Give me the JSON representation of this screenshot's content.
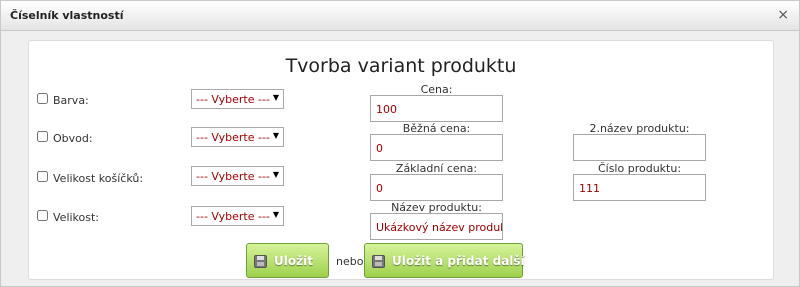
{
  "dialog": {
    "title": "Číselník vlastností",
    "close_glyph": "×"
  },
  "heading": "Tvorba variant produktu",
  "properties": [
    {
      "label": "Barva:",
      "checked": false,
      "select": "--- Vyberte ---"
    },
    {
      "label": "Obvod:",
      "checked": false,
      "select": "--- Vyberte ---"
    },
    {
      "label": "Velikost košíčků:",
      "checked": false,
      "select": "--- Vyberte ---"
    },
    {
      "label": "Velikost:",
      "checked": false,
      "select": "--- Vyberte ---"
    }
  ],
  "select_arrow": "▼",
  "fields": {
    "cena": {
      "label": "Cena:",
      "value": "100"
    },
    "bezna_cena": {
      "label": "Běžná cena:",
      "value": "0"
    },
    "zakladni_cena": {
      "label": "Základní cena:",
      "value": "0"
    },
    "nazev_produktu": {
      "label": "Název produktu:",
      "value": "Ukázkový název produk"
    },
    "nazev2": {
      "label": "2.název produktu:",
      "value": ""
    },
    "cislo_produktu": {
      "label": "Číslo produktu:",
      "value": "111"
    }
  },
  "buttons": {
    "save": "Uložit",
    "or": "nebo",
    "save_add": "Uložit a přidat další"
  },
  "colors": {
    "button_green": "#9ed14c",
    "value_text": "#a40000"
  }
}
